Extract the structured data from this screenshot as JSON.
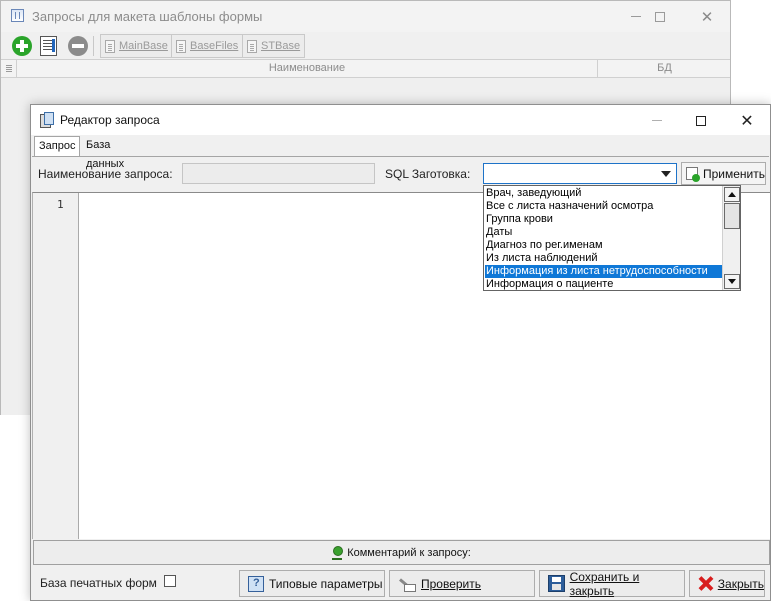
{
  "background_window": {
    "title": "Запросы для макета шаблоны формы",
    "toolbar": {
      "main_base": "MainBase",
      "base_files": "BaseFiles",
      "st_base": "STBase"
    },
    "columns": [
      "Наименование",
      "БД"
    ]
  },
  "dialog": {
    "title": "Редактор запроса",
    "tabs": [
      "Запрос",
      "База данных"
    ],
    "query_name_label": "Наименование запроса:",
    "query_name_value": "",
    "sql_template_label": "SQL Заготовка:",
    "sql_template_value": "",
    "apply_button": "Применить",
    "line_number": "1",
    "dropdown": {
      "items": [
        "Врач, заведующий",
        "Все с листа назначений осмотра",
        "Группа крови",
        "Даты",
        "Диагноз по рег.именам",
        "Из листа наблюдений",
        "Информация из листа нетрудоспособности",
        "Информация о пациенте"
      ],
      "selected_index": 6
    },
    "comment_bar": "Комментарий к запросу:",
    "print_forms_base_label": "База печатных форм",
    "print_forms_base_checked": false,
    "buttons": {
      "typical_params": "Типовые параметры",
      "check": "Проверить",
      "save_close": "Сохранить и закрыть",
      "close": "Закрыть"
    }
  },
  "colors": {
    "selection": "#0f78d7",
    "combo_focus_border": "#1e73c8",
    "add_icon": "#2aa42a",
    "close_icon": "#d81e1e"
  }
}
